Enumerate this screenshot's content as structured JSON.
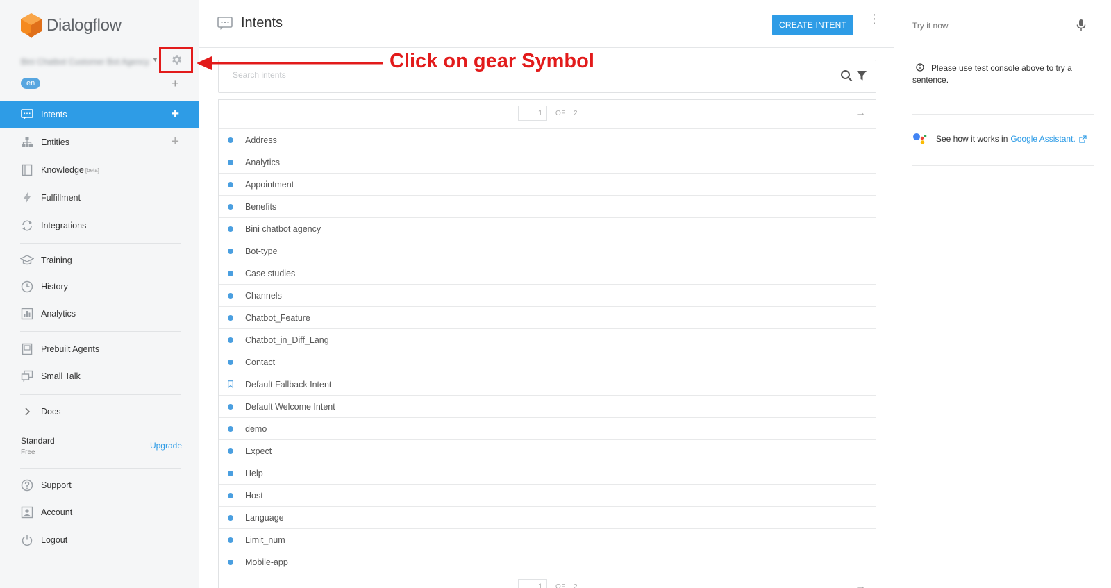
{
  "app": {
    "name": "Dialogflow",
    "agent_name": "Bini Chatbot Customer Bot Agency",
    "language": "en"
  },
  "sidebar": {
    "items": [
      {
        "label": "Intents",
        "icon": "chat-icon",
        "active": true,
        "has_add": true
      },
      {
        "label": "Entities",
        "icon": "hierarchy-icon",
        "has_add": true
      },
      {
        "label": "Knowledge",
        "icon": "book-icon",
        "badge": "[beta]"
      },
      {
        "label": "Fulfillment",
        "icon": "bolt-icon"
      },
      {
        "label": "Integrations",
        "icon": "sync-icon"
      },
      {
        "label": "Training",
        "icon": "graduation-cap-icon"
      },
      {
        "label": "History",
        "icon": "clock-icon"
      },
      {
        "label": "Analytics",
        "icon": "bar-chart-icon"
      },
      {
        "label": "Prebuilt Agents",
        "icon": "agent-book-icon"
      },
      {
        "label": "Small Talk",
        "icon": "chat-bubbles-icon"
      },
      {
        "label": "Docs",
        "icon": "chevron-right-icon"
      },
      {
        "label": "Support",
        "icon": "question-icon"
      },
      {
        "label": "Account",
        "icon": "account-icon"
      },
      {
        "label": "Logout",
        "icon": "power-icon"
      }
    ],
    "plan": {
      "name": "Standard",
      "tier": "Free",
      "upgrade_label": "Upgrade"
    }
  },
  "header": {
    "title": "Intents",
    "create_button": "CREATE INTENT"
  },
  "search": {
    "placeholder": "Search intents"
  },
  "pager": {
    "current": "1",
    "of_label": "OF",
    "total": "2"
  },
  "intents": [
    {
      "name": "Address"
    },
    {
      "name": "Analytics"
    },
    {
      "name": "Appointment"
    },
    {
      "name": "Benefits"
    },
    {
      "name": "Bini chatbot agency"
    },
    {
      "name": "Bot-type"
    },
    {
      "name": "Case studies"
    },
    {
      "name": "Channels"
    },
    {
      "name": "Chatbot_Feature"
    },
    {
      "name": "Chatbot_in_Diff_Lang"
    },
    {
      "name": "Contact"
    },
    {
      "name": "Default Fallback Intent",
      "fallback": true
    },
    {
      "name": "Default Welcome Intent"
    },
    {
      "name": "demo"
    },
    {
      "name": "Expect"
    },
    {
      "name": "Help"
    },
    {
      "name": "Host"
    },
    {
      "name": "Language"
    },
    {
      "name": "Limit_num"
    },
    {
      "name": "Mobile-app"
    }
  ],
  "annotation": {
    "text": "Click on gear Symbol",
    "color": "#e21b1b"
  },
  "right_panel": {
    "try_placeholder": "Try it now",
    "info_text": "Please use test console above to try a sentence.",
    "ga_prefix": "See how it works in",
    "ga_link": "Google Assistant."
  },
  "colors": {
    "accent": "#2e9ce6",
    "annotation": "#e21b1b",
    "logo": "#f58a1f"
  }
}
